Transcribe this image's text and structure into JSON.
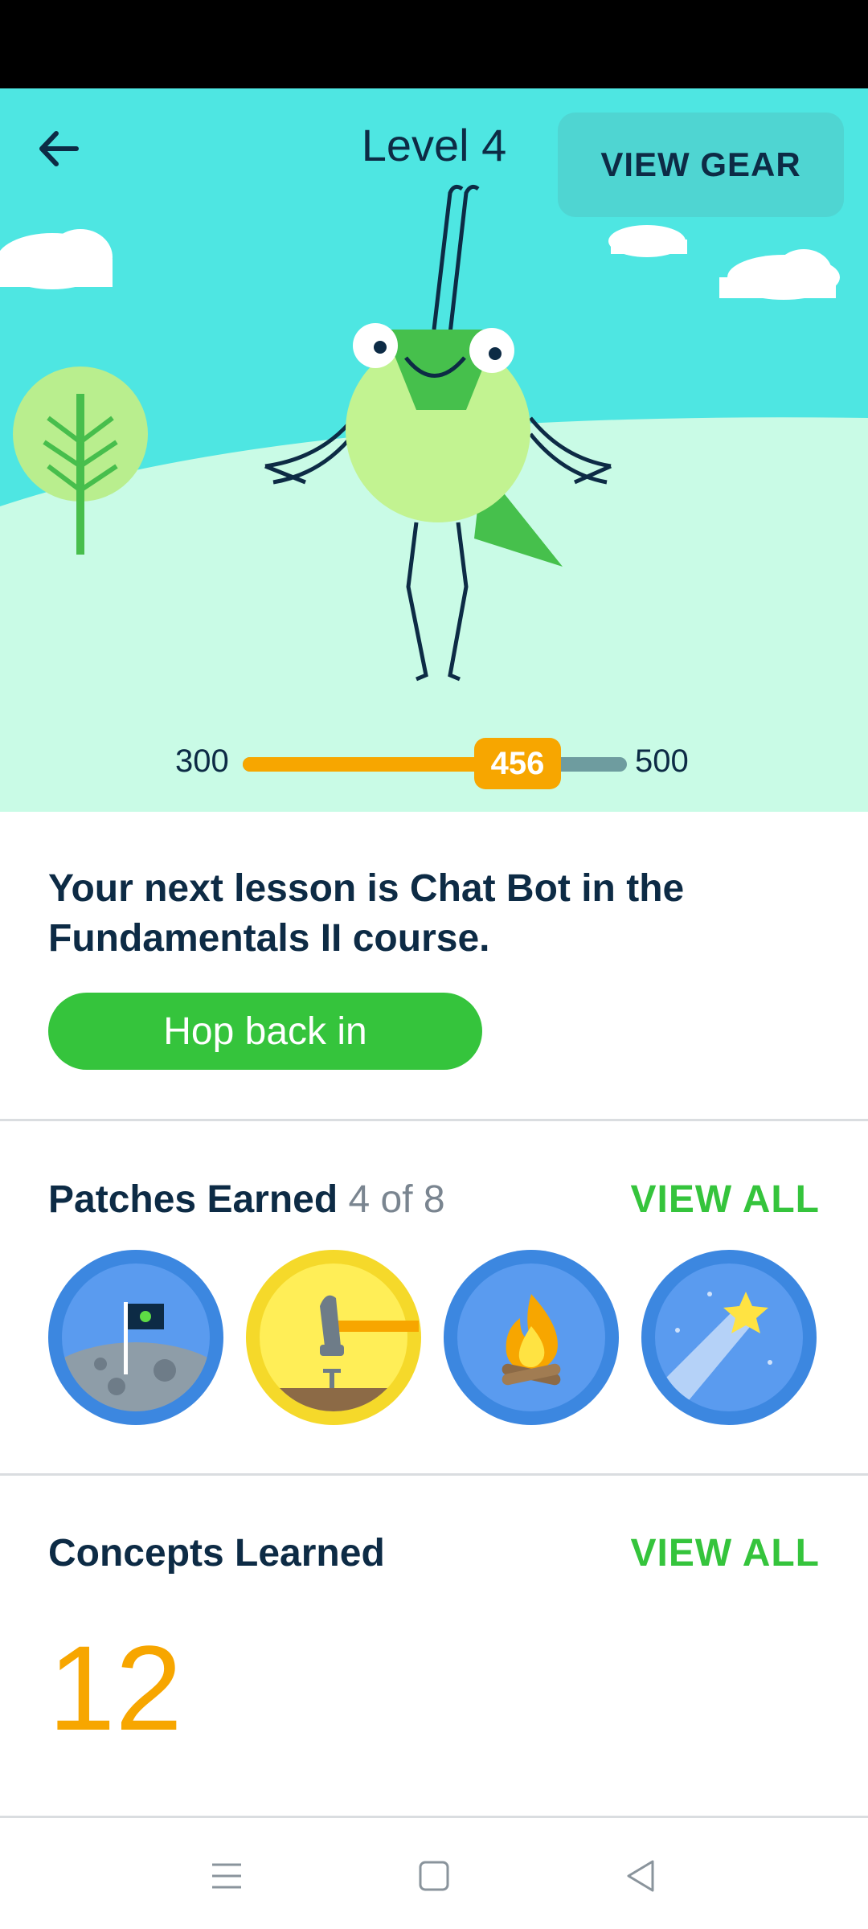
{
  "header": {
    "back_icon": "arrow-left-icon",
    "level_title": "Level 4",
    "gear_button_label": "VIEW GEAR"
  },
  "xp": {
    "min": "300",
    "max": "500",
    "current": "456",
    "progress_fraction": 0.78
  },
  "lesson": {
    "text": "Your next lesson is Chat Bot in the Fundamentals II course.",
    "button_label": "Hop back in"
  },
  "patches": {
    "title": "Patches Earned",
    "count": "4 of 8",
    "view_all_label": "VIEW ALL",
    "items": [
      {
        "icon": "moon-flag-patch-icon"
      },
      {
        "icon": "hammer-patch-icon"
      },
      {
        "icon": "campfire-patch-icon"
      },
      {
        "icon": "shooting-star-patch-icon"
      }
    ]
  },
  "concepts": {
    "title": "Concepts Learned",
    "view_all_label": "VIEW ALL",
    "count": "12"
  },
  "navbar": {
    "items": [
      {
        "icon": "menu-icon"
      },
      {
        "icon": "home-square-icon"
      },
      {
        "icon": "back-triangle-icon"
      }
    ]
  },
  "colors": {
    "sky": "#4EE6E2",
    "accent_green": "#35C43C",
    "xp_orange": "#F7A600",
    "text_navy": "#0D2B45"
  }
}
